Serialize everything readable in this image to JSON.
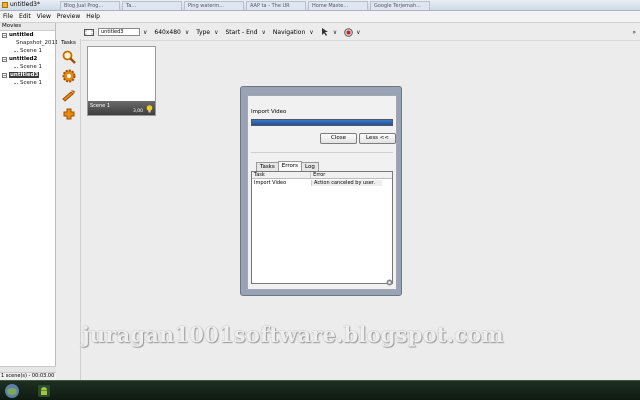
{
  "window": {
    "title": "untitled3*"
  },
  "browser_tabs": [
    "Blog Jual Prog...",
    "Ta...",
    "Ping waterm...",
    "AAP ta - The UR",
    "Home Maste...",
    "Google Terjemah..."
  ],
  "menu": [
    "File",
    "Edit",
    "View",
    "Preview",
    "Help"
  ],
  "toolbar": {
    "movie_name": "untitled3",
    "resolution": "640x480",
    "type_label": "Type",
    "start_end_label": "Start - End",
    "navigation_label": "Navigation"
  },
  "movies_panel": {
    "header": "Movies",
    "items": [
      {
        "name": "untitled",
        "children": [
          "Snapshot_2011",
          "Scene 1"
        ]
      },
      {
        "name": "untitled2",
        "children": [
          "Scene 1"
        ]
      },
      {
        "name": "untitled3",
        "children": [
          "Scene 1"
        ],
        "selected": true
      }
    ],
    "status": "1 scene(s) - 00:03.00"
  },
  "tasks_panel": {
    "label": "Tasks",
    "icons": [
      "search-icon",
      "gear-icon",
      "tools-icon",
      "puzzle-icon"
    ]
  },
  "scene_card": {
    "name": "Scene 1",
    "duration": "3,00"
  },
  "import_dialog": {
    "title": "Import Video",
    "progress": 1.0,
    "close_label": "Close",
    "less_label": "Less <<",
    "tabs": [
      "Tasks",
      "Errors",
      "Log"
    ],
    "active_tab": "Errors",
    "columns": [
      "Task",
      "Error"
    ],
    "rows": [
      {
        "task": "Import Video",
        "error": "Action canceled by user."
      }
    ]
  },
  "watermark": "juragan1001software.blogspot.com",
  "colors": {
    "progress": "#1e4f9c",
    "taskbar": "#0d1a10",
    "dialog_frame": "#9aa3b4"
  }
}
